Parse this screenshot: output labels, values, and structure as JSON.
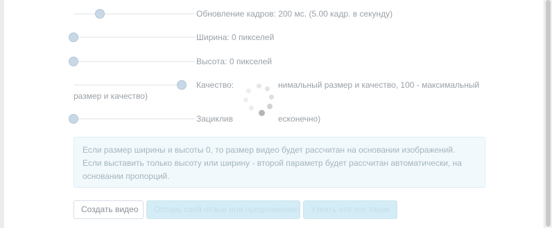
{
  "settings": {
    "fps": {
      "label": "Обновление кадров: 200 мс. (5.00 кадр. в секунду)",
      "value": 0.2
    },
    "width": {
      "label": "Ширина: 0 пикселей",
      "value": 0
    },
    "height": {
      "label": "Высота: 0 пикселей",
      "value": 0
    },
    "quality": {
      "label_part1": "Качество:",
      "label_part2": "нимальный размер и качество, 100 - максимальный",
      "label_part3": "размер и качество)",
      "value": 1
    },
    "loop": {
      "label_part1": "Зациклив",
      "label_part2": "есконечно)",
      "value": 0
    }
  },
  "info_text": "Если размер ширины и высоты 0, то размер видео будет рассчитан на основании изображений. Если выставить только высоту или ширину - второй параметр будет рассчитан автоматически, на основании пропорций.",
  "buttons": {
    "create_video": "Создать видео",
    "feedback": "Оставь свой отзыв или предложение!",
    "learn_more": "Узнать что это такое"
  },
  "colors": {
    "handle": "#c9d8e6",
    "info_bg": "#f2f9fc",
    "info_button": "#d4ecf5"
  }
}
